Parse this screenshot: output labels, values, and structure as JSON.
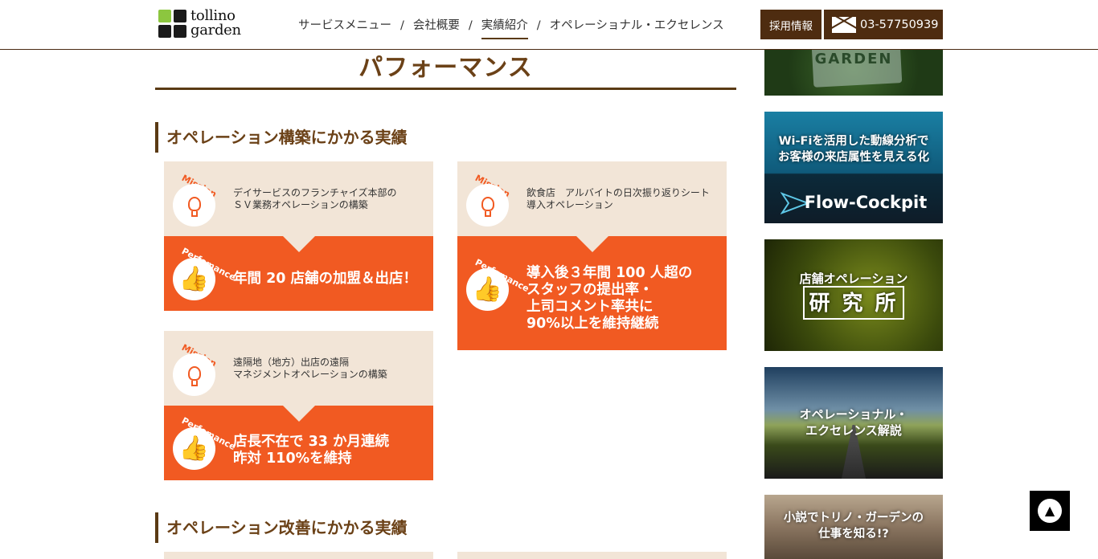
{
  "header": {
    "logo": {
      "line1": "tollino",
      "line2": "garden",
      "colors": [
        "#8cc63f",
        "#1a1a1a",
        "#1a1a1a",
        "#1a1a1a"
      ]
    },
    "nav": [
      {
        "label": "サービスメニュー",
        "active": false
      },
      {
        "label": "会社概要",
        "active": false
      },
      {
        "label": "実績紹介",
        "active": true
      },
      {
        "label": "オペレーショナル・エクセレンス",
        "active": false
      }
    ],
    "nav_separator": "/",
    "recruit_label": "採用情報",
    "phone_label": "03-57750939"
  },
  "page_title": "パフォーマンス",
  "sections": [
    {
      "title": "オペレーション構築にかかる実績",
      "cards": [
        {
          "mission_label": "Mission",
          "mission_text": "デイサービスのフランチャイズ本部の\nＳＶ業務オペレーションの構築",
          "perf_label": "Perfomance",
          "perf_text": "年間 20 店舗の加盟＆出店！"
        },
        {
          "mission_label": "Mission",
          "mission_text": "飲食店　アルバイトの日次振り返りシート\n導入オペレーション",
          "perf_label": "Perfomance",
          "perf_text": "導入後３年間 100 人超の\nスタッフの提出率・\n上司コメント率共に\n90%以上を維持継続"
        },
        {
          "mission_label": "Mission",
          "mission_text": "遠隔地（地方）出店の遠隔\nマネジメントオペレーションの構築",
          "perf_label": "Perfomance",
          "perf_text": "店長不在で 33 か月連続\n昨対 110%を維持"
        }
      ]
    },
    {
      "title": "オペレーション改善にかかる実績",
      "cards": []
    }
  ],
  "sidebar": {
    "banners": [
      {
        "name": "garden-sign-banner",
        "text": "GARDEN"
      },
      {
        "name": "flow-cockpit-banner",
        "text": "Wi-Fiを活用した動線分析で\nお客様の来店属性を見える化",
        "sub": "Flow-Cockpit"
      },
      {
        "name": "store-operation-lab-banner",
        "text": "店舗オペレーション",
        "sub": "研 究 所"
      },
      {
        "name": "operational-excellence-banner",
        "text": "オペレーショナル・\nエクセレンス解説"
      },
      {
        "name": "novel-banner",
        "text": "小説でトリノ・ガーデンの\n仕事を知る!?"
      }
    ]
  },
  "to_top_label": "▲",
  "colors": {
    "brown": "#5a3a14",
    "orange": "#f15a22",
    "beige": "#f2e5d7",
    "logo_green": "#8cc63f"
  }
}
